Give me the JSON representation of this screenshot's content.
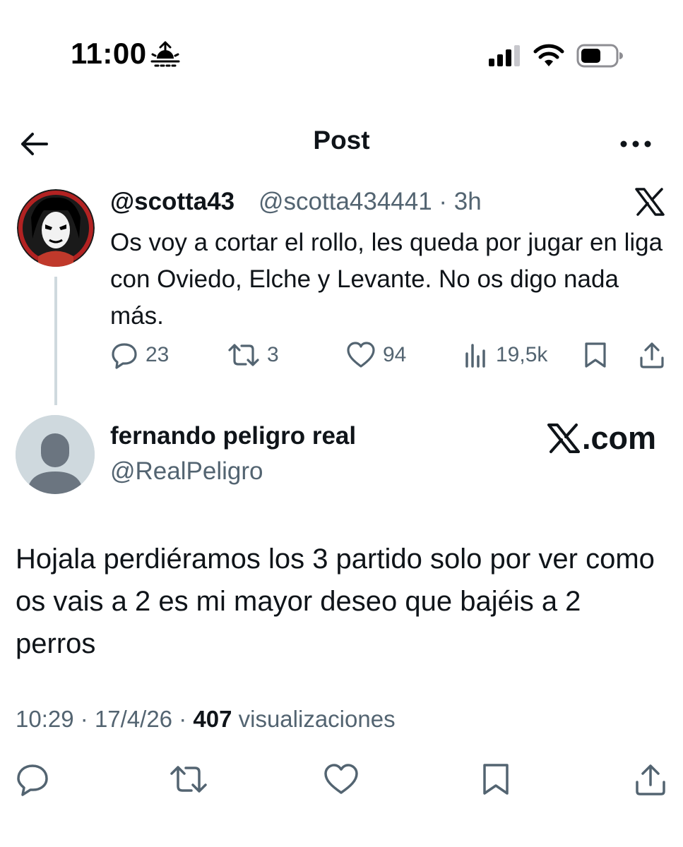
{
  "status_bar": {
    "time": "11:00",
    "icons": [
      "sunrise-icon",
      "signal-icon",
      "wifi-icon",
      "battery-icon"
    ]
  },
  "header": {
    "title": "Post",
    "back_icon": "back-arrow-icon",
    "more_icon": "more-icon"
  },
  "quoted_tweet": {
    "name": "@scotta43",
    "handle_time": "@scotta434441 · 3h",
    "text": "Os voy a cortar el rollo, les queda por jugar en liga con Oviedo, Elche y Levante. No os digo nada más.",
    "replies": "23",
    "reposts": "3",
    "likes": "94",
    "views": "19,5k"
  },
  "main_post": {
    "name": "fernando peligro real",
    "handle": "@RealPeligro",
    "watermark": ".com",
    "text": "Hojala perdiéramos los 3 partido solo por ver como os vais a 2 es mi mayor deseo que bajéis a 2 perros",
    "time": "10:29",
    "date": "17/4/26",
    "views_count": "407",
    "views_label": "visualizaciones"
  },
  "colors": {
    "text": "#0f1419",
    "secondary": "#536471",
    "thread_line": "#cfd9de",
    "avatar_bg": "#cfd9de"
  }
}
